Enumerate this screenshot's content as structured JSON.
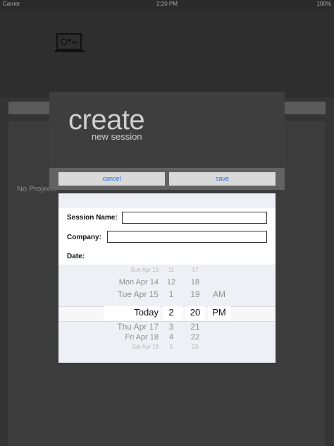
{
  "status_bar": {
    "carrier": "Carrier",
    "time": "2:20 PM",
    "battery": "100%"
  },
  "background": {
    "empty_text": "No Projects"
  },
  "modal": {
    "title": "create",
    "subtitle": "new session",
    "cancel_label": "cancel",
    "save_label": "save"
  },
  "form": {
    "session_name_label": "Session Name:",
    "session_name_value": "",
    "company_label": "Company:",
    "company_value": "",
    "date_label": "Date:"
  },
  "picker": {
    "dates": [
      "Sun Apr 13",
      "Mon Apr 14",
      "Tue Apr 15",
      "Today",
      "Thu Apr 17",
      "Fri Apr 18",
      "Sat Apr 19"
    ],
    "hours": [
      "11",
      "12",
      "1",
      "2",
      "3",
      "4",
      "5"
    ],
    "minutes": [
      "17",
      "18",
      "19",
      "20",
      "21",
      "22",
      "23"
    ],
    "ampm": [
      "AM",
      "PM"
    ],
    "selected": {
      "date": "Today",
      "hour": "2",
      "minute": "20",
      "ampm": "PM"
    }
  },
  "colors": {
    "accent": "#2a6fd6",
    "background": "#343434",
    "modal": "#3e3e3e"
  }
}
